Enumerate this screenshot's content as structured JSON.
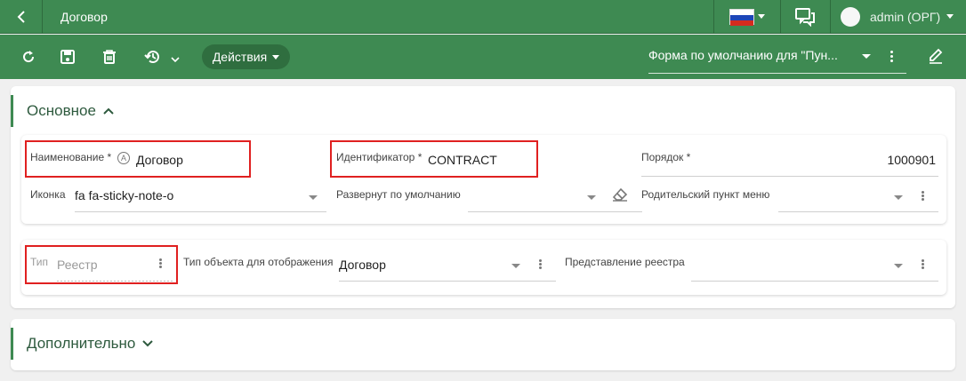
{
  "header": {
    "title": "Договор",
    "user": "admin (ОРГ)"
  },
  "toolbar": {
    "actions_label": "Действия",
    "form_select_value": "Форма по умолчанию для \"Пун..."
  },
  "sections": {
    "main": {
      "title": "Основное",
      "name_label": "Наименование",
      "name_value": "Договор",
      "id_label": "Идентификатор",
      "id_value": "CONTRACT",
      "order_label": "Порядок",
      "order_value": "1000901",
      "icon_label": "Иконка",
      "icon_value": "fa fa-sticky-note-o",
      "expanded_label": "Развернут по умолчанию",
      "parent_label": "Родительский пункт меню",
      "type_label": "Тип",
      "type_value": "Реестр",
      "object_type_label": "Тип объекта для отображения",
      "object_type_value": "Договор",
      "registry_view_label": "Представление реестра",
      "required_mark": "*",
      "auto_mark": "A"
    },
    "extra": {
      "title": "Дополнительно"
    }
  },
  "colors": {
    "header_green": "#3e8a52",
    "dark_green": "#2f6e3f",
    "highlight_red": "#e02020"
  }
}
